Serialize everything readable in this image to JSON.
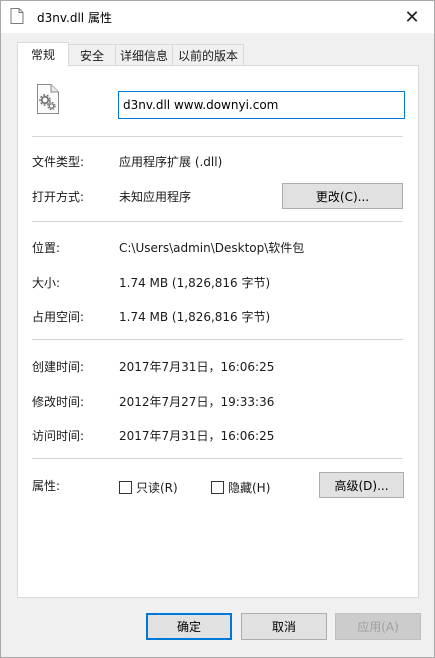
{
  "window": {
    "title": "d3nv.dll 属性",
    "close_glyph": "✕"
  },
  "tabs": [
    {
      "label": "常规",
      "active": true
    },
    {
      "label": "安全",
      "active": false
    },
    {
      "label": "详细信息",
      "active": false
    },
    {
      "label": "以前的版本",
      "active": false
    }
  ],
  "general": {
    "file_name": "d3nv.dll www.downyi.com",
    "file_type_label": "文件类型:",
    "file_type_value": "应用程序扩展 (.dll)",
    "opens_with_label": "打开方式:",
    "opens_with_value": "未知应用程序",
    "change_button": "更改(C)...",
    "location_label": "位置:",
    "location_value": "C:\\Users\\admin\\Desktop\\软件包",
    "size_label": "大小:",
    "size_value": "1.74 MB (1,826,816 字节)",
    "size_on_disk_label": "占用空间:",
    "size_on_disk_value": "1.74 MB (1,826,816 字节)",
    "created_label": "创建时间:",
    "created_value": "2017年7月31日，16:06:25",
    "modified_label": "修改时间:",
    "modified_value": "2012年7月27日，19:33:36",
    "accessed_label": "访问时间:",
    "accessed_value": "2017年7月31日，16:06:25",
    "attributes_label": "属性:",
    "readonly_label": "只读(R)",
    "readonly_checked": false,
    "hidden_label": "隐藏(H)",
    "hidden_checked": false,
    "advanced_button": "高级(D)..."
  },
  "footer": {
    "ok_button": "确定",
    "cancel_button": "取消",
    "apply_button": "应用(A)",
    "apply_enabled": false
  },
  "colors": {
    "accent": "#0078d7",
    "panel_bg": "#ffffff",
    "window_bg": "#f0f0f0"
  }
}
